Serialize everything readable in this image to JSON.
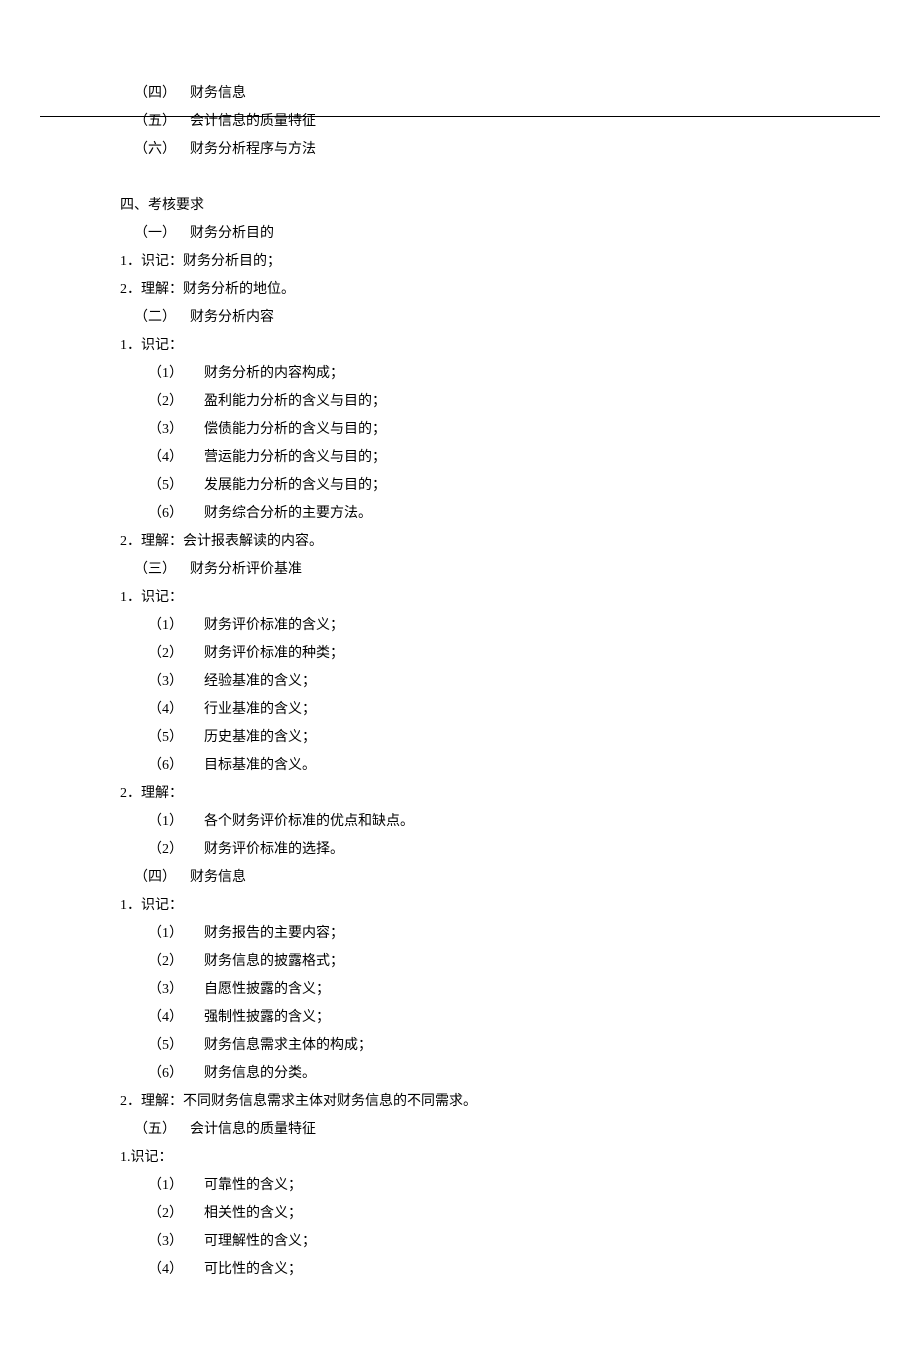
{
  "top_items": [
    {
      "m": "（四）",
      "t": "财务信息"
    },
    {
      "m": "（五）",
      "t": "会计信息的质量特征"
    },
    {
      "m": "（六）",
      "t": "财务分析程序与方法"
    }
  ],
  "section4_title": "四、考核要求",
  "s1": {
    "heading": {
      "m": "（一）",
      "t": "财务分析目的"
    },
    "lines": [
      {
        "m": "1．",
        "t": "识记：财务分析目的；"
      },
      {
        "m": "2．",
        "t": "理解：财务分析的地位。"
      }
    ]
  },
  "s2": {
    "heading": {
      "m": "（二）",
      "t": "财务分析内容"
    },
    "p1": {
      "m": "1．",
      "t": "识记："
    },
    "list1": [
      {
        "m": "（1）",
        "t": "财务分析的内容构成；"
      },
      {
        "m": "（2）",
        "t": "盈利能力分析的含义与目的；"
      },
      {
        "m": "（3）",
        "t": "偿债能力分析的含义与目的；"
      },
      {
        "m": "（4）",
        "t": "营运能力分析的含义与目的；"
      },
      {
        "m": "（5）",
        "t": "发展能力分析的含义与目的；"
      },
      {
        "m": "（6）",
        "t": "财务综合分析的主要方法。"
      }
    ],
    "p2": {
      "m": "2．",
      "t": "理解：会计报表解读的内容。"
    }
  },
  "s3": {
    "heading": {
      "m": "（三）",
      "t": "财务分析评价基准"
    },
    "p1": {
      "m": "1．",
      "t": "识记："
    },
    "list1": [
      {
        "m": "（1）",
        "t": "财务评价标准的含义；"
      },
      {
        "m": "（2）",
        "t": "财务评价标准的种类；"
      },
      {
        "m": "（3）",
        "t": "经验基准的含义；"
      },
      {
        "m": "（4）",
        "t": "行业基准的含义；"
      },
      {
        "m": "（5）",
        "t": "历史基准的含义；"
      },
      {
        "m": "（6）",
        "t": "目标基准的含义。"
      }
    ],
    "p2": {
      "m": "2．",
      "t": "理解："
    },
    "list2": [
      {
        "m": "（1）",
        "t": "各个财务评价标准的优点和缺点。"
      },
      {
        "m": "（2）",
        "t": "财务评价标准的选择。"
      }
    ]
  },
  "s4": {
    "heading": {
      "m": "（四）",
      "t": "财务信息"
    },
    "p1": {
      "m": "1．",
      "t": "识记："
    },
    "list1": [
      {
        "m": "（1）",
        "t": "财务报告的主要内容；"
      },
      {
        "m": "（2）",
        "t": "财务信息的披露格式；"
      },
      {
        "m": "（3）",
        "t": "自愿性披露的含义；"
      },
      {
        "m": "（4）",
        "t": "强制性披露的含义；"
      },
      {
        "m": "（5）",
        "t": "财务信息需求主体的构成；"
      },
      {
        "m": "（6）",
        "t": "财务信息的分类。"
      }
    ],
    "p2": {
      "m": "2．",
      "t": "理解：不同财务信息需求主体对财务信息的不同需求。"
    }
  },
  "s5": {
    "heading": {
      "m": "（五）",
      "t": "会计信息的质量特征"
    },
    "p1": {
      "m": "1.",
      "t": "识记："
    },
    "list1": [
      {
        "m": "（1）",
        "t": "可靠性的含义；"
      },
      {
        "m": "（2）",
        "t": "相关性的含义；"
      },
      {
        "m": "（3）",
        "t": "可理解性的含义；"
      },
      {
        "m": "（4）",
        "t": "可比性的含义；"
      }
    ]
  }
}
